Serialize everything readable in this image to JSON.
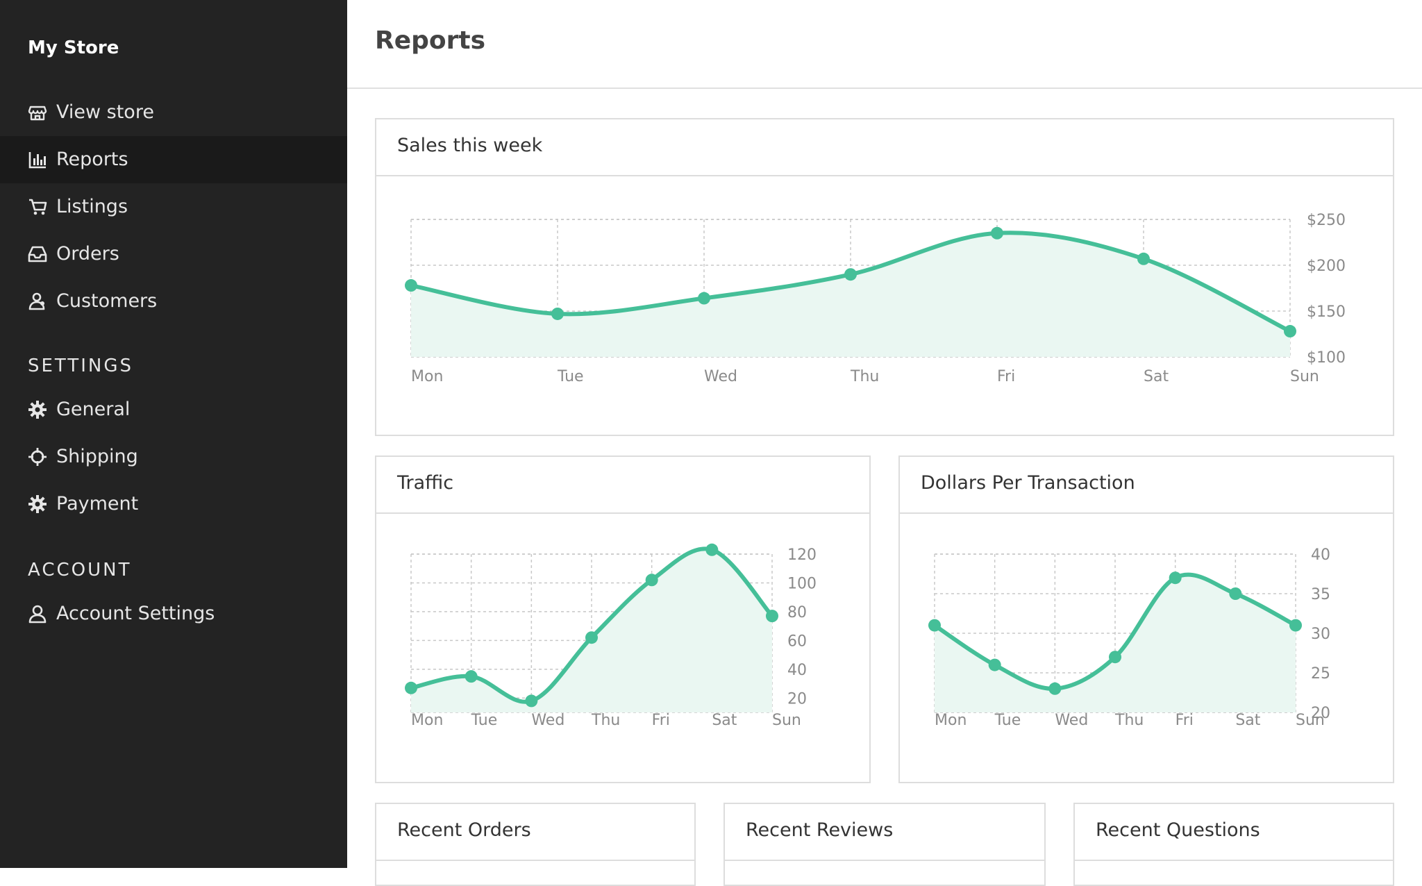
{
  "sidebar": {
    "brand": "My Store",
    "items": [
      {
        "label": "View store",
        "icon": "store-icon"
      },
      {
        "label": "Reports",
        "icon": "bar-chart-icon"
      },
      {
        "label": "Listings",
        "icon": "cart-icon"
      },
      {
        "label": "Orders",
        "icon": "inbox-icon"
      },
      {
        "label": "Customers",
        "icon": "users-icon"
      }
    ],
    "settings_title": "SETTINGS",
    "settings_items": [
      {
        "label": "General",
        "icon": "gear-icon"
      },
      {
        "label": "Shipping",
        "icon": "crosshair-icon"
      },
      {
        "label": "Payment",
        "icon": "gear-icon"
      }
    ],
    "account_title": "ACCOUNT",
    "account_items": [
      {
        "label": "Account Settings",
        "icon": "user-icon"
      }
    ]
  },
  "header": {
    "title": "Reports"
  },
  "cards": {
    "sales": "Sales this week",
    "traffic": "Traffic",
    "dpt": "Dollars Per Transaction",
    "recent_orders": "Recent Orders",
    "recent_reviews": "Recent Reviews",
    "recent_questions": "Recent Questions"
  },
  "colors": {
    "accent": "#45bf98",
    "fill": "#eaf7f2",
    "sidebar_bg": "#232323"
  },
  "chart_data": [
    {
      "type": "area",
      "title": "Sales this week",
      "categories": [
        "Mon",
        "Tue",
        "Wed",
        "Thu",
        "Fri",
        "Sat",
        "Sun"
      ],
      "values": [
        178,
        147,
        164,
        190,
        235,
        207,
        128
      ],
      "ylim": [
        100,
        250
      ],
      "yticks": [
        "$100",
        "$150",
        "$200",
        "$250"
      ],
      "grid": true
    },
    {
      "type": "area",
      "title": "Traffic",
      "categories": [
        "Mon",
        "Tue",
        "Wed",
        "Thu",
        "Fri",
        "Sat",
        "Sun"
      ],
      "values": [
        27,
        35,
        18,
        62,
        102,
        123,
        77
      ],
      "ylim": [
        10,
        120
      ],
      "yticks": [
        "20",
        "40",
        "60",
        "80",
        "100",
        "120"
      ],
      "grid": true
    },
    {
      "type": "area",
      "title": "Dollars Per Transaction",
      "categories": [
        "Mon",
        "Tue",
        "Wed",
        "Thu",
        "Fri",
        "Sat",
        "Sun"
      ],
      "values": [
        31,
        26,
        23,
        27,
        37,
        35,
        31
      ],
      "ylim": [
        20,
        40
      ],
      "yticks": [
        "20",
        "25",
        "30",
        "35",
        "40"
      ],
      "grid": true
    }
  ]
}
